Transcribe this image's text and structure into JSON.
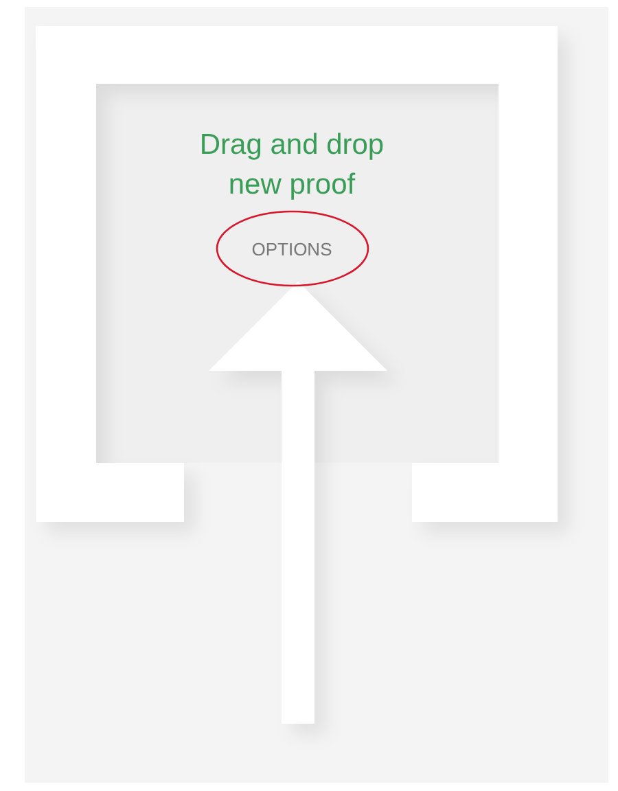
{
  "drop_zone": {
    "heading": "Drag and drop new proof",
    "options": {
      "label": "OPTIONS",
      "circled": true
    }
  }
}
